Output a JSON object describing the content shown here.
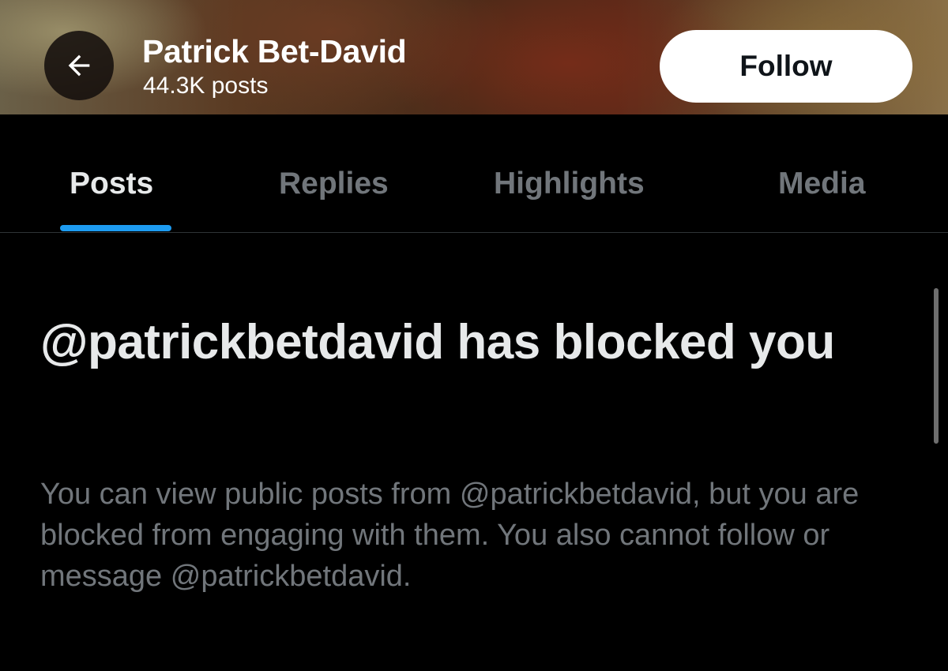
{
  "header": {
    "name": "Patrick Bet-David",
    "post_count": "44.3K posts",
    "back_icon": "arrow-left-icon",
    "follow_label": "Follow"
  },
  "tabs": [
    {
      "label": "Posts",
      "active": true
    },
    {
      "label": "Replies",
      "active": false
    },
    {
      "label": "Highlights",
      "active": false
    },
    {
      "label": "Media",
      "active": false
    }
  ],
  "blocked": {
    "title": "@patrickbetdavid has blocked you",
    "description": "You can view public posts from @patrickbetdavid, but you are blocked from engaging with them. You also cannot follow or message @patrickbetdavid."
  },
  "colors": {
    "background": "#000000",
    "accent": "#1d9bf0",
    "primary_text": "#e7e9ea",
    "secondary_text": "#71767b",
    "follow_button_bg": "#ffffff"
  }
}
